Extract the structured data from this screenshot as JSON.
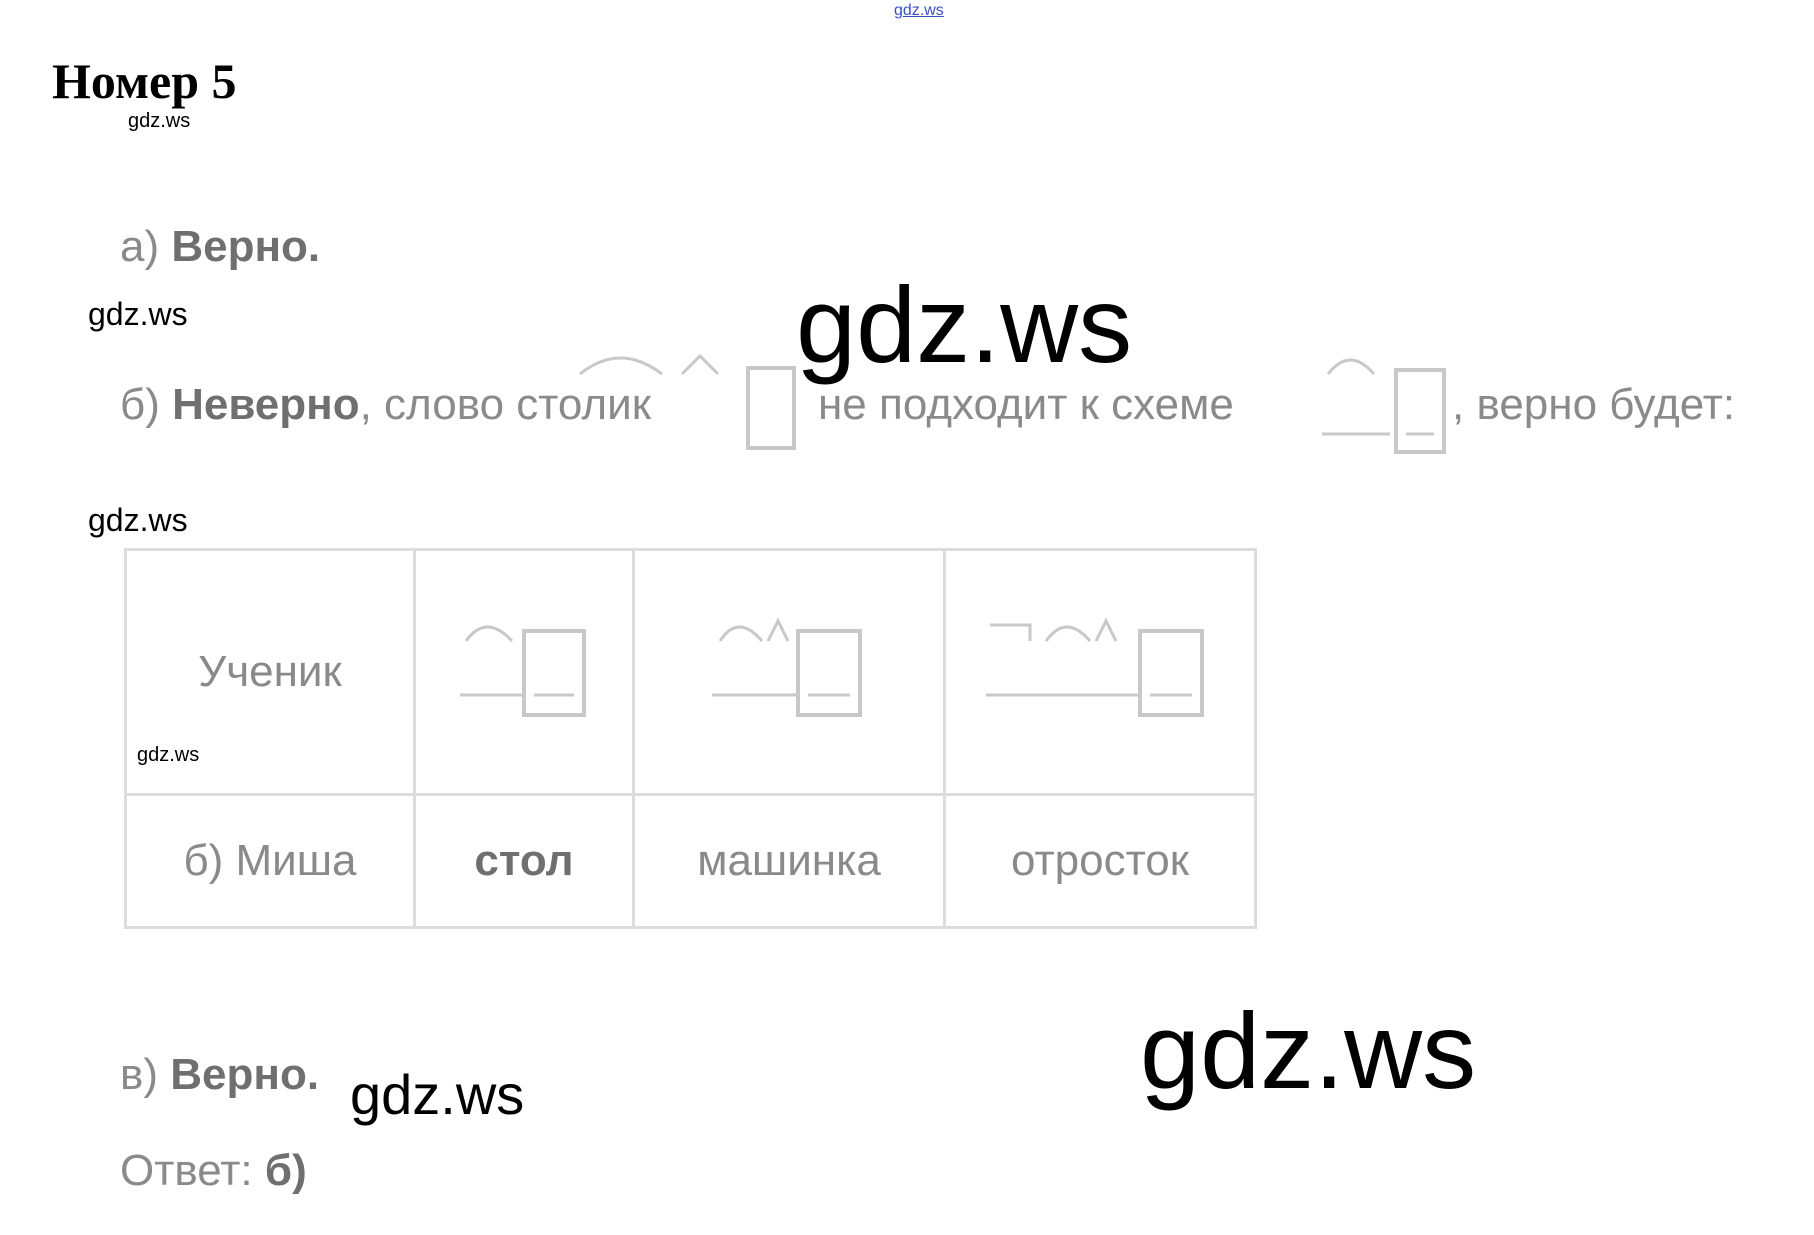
{
  "watermarks": {
    "top": "gdz.ws",
    "under_title": "gdz.ws",
    "left_1": "gdz.ws",
    "left_2": "gdz.ws",
    "big_1": "gdz.ws",
    "in_table": "gdz.ws",
    "mid_bottom": "gdz.ws",
    "big_2": "gdz.ws"
  },
  "title": "Номер 5",
  "line_a": {
    "label": "а)",
    "verdict": "Верно."
  },
  "line_b": {
    "label": "б)",
    "verdict": "Неверно",
    "text1": ", слово столик",
    "text2": "не подходит к схеме",
    "text3": ", верно будет:"
  },
  "table": {
    "header_first": "Ученик",
    "row_label": "б) Миша",
    "words": [
      "стол",
      "машинка",
      "отросток"
    ]
  },
  "line_c": {
    "label": "в)",
    "verdict": "Верно."
  },
  "answer": {
    "label": "Ответ:",
    "value": "б)"
  },
  "colors": {
    "text_gray": "#8a8a8a",
    "table_border": "#dcdcdc",
    "link_blue": "#3b4fc9"
  },
  "icons": [
    "morpheme-scheme-icon",
    "suffix-arc-icon",
    "root-arc-icon",
    "ending-box-icon"
  ]
}
